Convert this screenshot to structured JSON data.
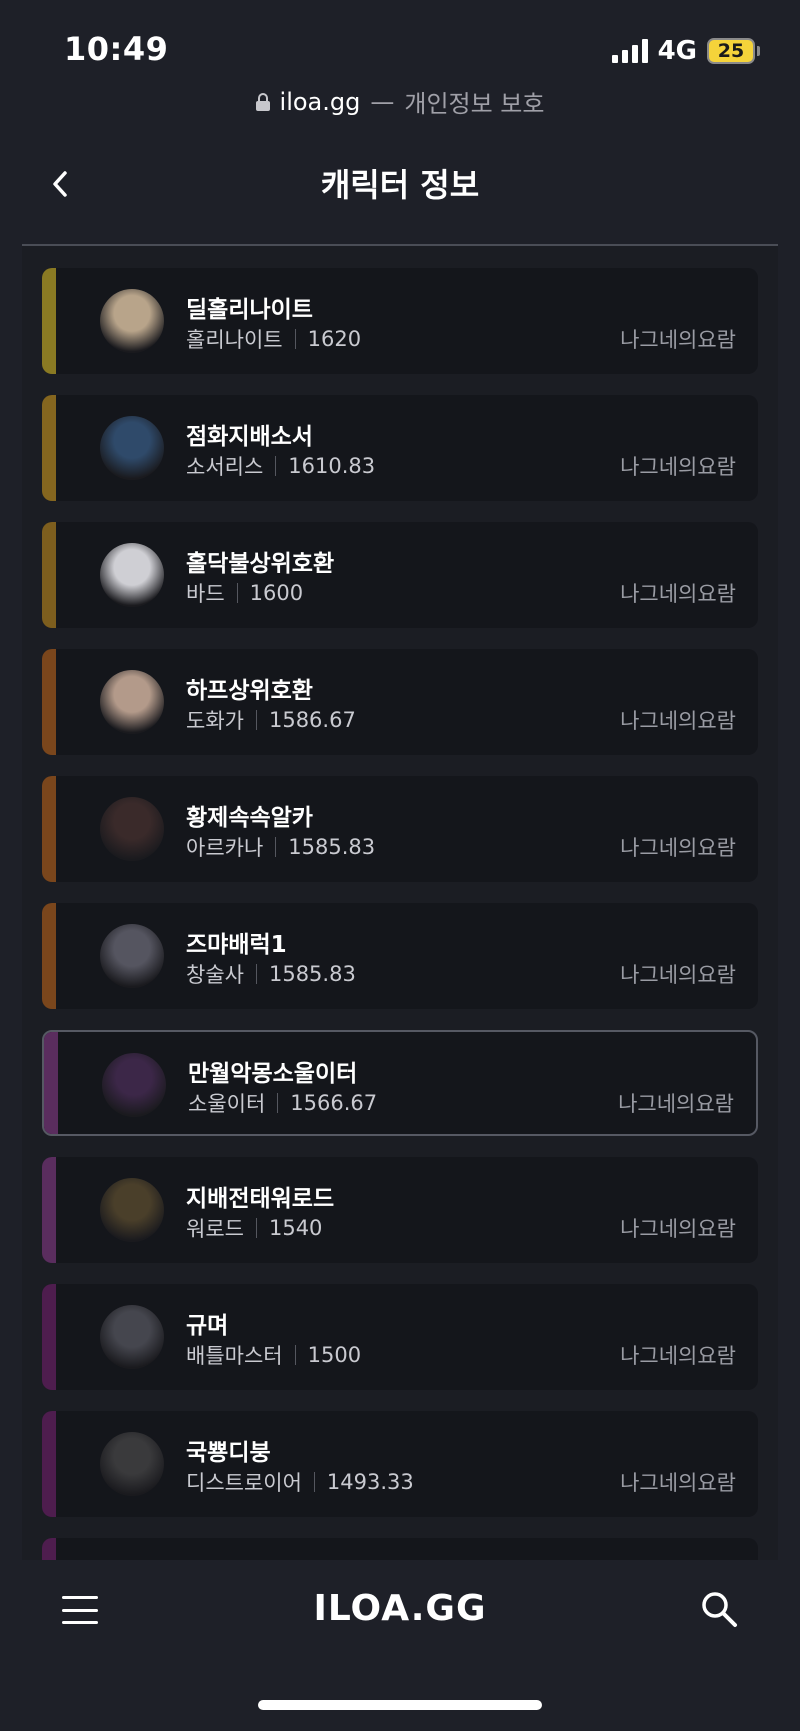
{
  "status": {
    "time": "10:49",
    "network": "4G",
    "battery": "25"
  },
  "browser": {
    "domain": "iloa.gg",
    "separator": "—",
    "privacy": "개인정보 보호"
  },
  "header": {
    "title": "캐릭터 정보"
  },
  "characters": [
    {
      "name": "딜홀리나이트",
      "class": "홀리나이트",
      "level": "1620",
      "server": "나그네의요람",
      "stripe": "#8a7a23",
      "avatar": "#b8a48a"
    },
    {
      "name": "점화지배소서",
      "class": "소서리스",
      "level": "1610.83",
      "server": "나그네의요람",
      "stripe": "#85661f",
      "avatar": "#2f4a6a"
    },
    {
      "name": "홀닥불상위호환",
      "class": "바드",
      "level": "1600",
      "server": "나그네의요람",
      "stripe": "#7d5e1e",
      "avatar": "#cfcfd4"
    },
    {
      "name": "하프상위호환",
      "class": "도화가",
      "level": "1586.67",
      "server": "나그네의요람",
      "stripe": "#7a461c",
      "avatar": "#b39a8a"
    },
    {
      "name": "황제속속알카",
      "class": "아르카나",
      "level": "1585.83",
      "server": "나그네의요람",
      "stripe": "#7a461c",
      "avatar": "#3a2a2a"
    },
    {
      "name": "즈먀배럭1",
      "class": "창술사",
      "level": "1585.83",
      "server": "나그네의요람",
      "stripe": "#7a461c",
      "avatar": "#555560"
    },
    {
      "name": "만월악몽소울이터",
      "class": "소울이터",
      "level": "1566.67",
      "server": "나그네의요람",
      "stripe": "#5a2d5e",
      "avatar": "#3c2748"
    },
    {
      "name": "지배전태워로드",
      "class": "워로드",
      "level": "1540",
      "server": "나그네의요람",
      "stripe": "#5a2d5e",
      "avatar": "#4a3f2a"
    },
    {
      "name": "규며",
      "class": "배틀마스터",
      "level": "1500",
      "server": "나그네의요람",
      "stripe": "#4e1d4e",
      "avatar": "#45464e"
    },
    {
      "name": "국뿅디붕",
      "class": "디스트로이어",
      "level": "1493.33",
      "server": "나그네의요람",
      "stripe": "#4e1d4e",
      "avatar": "#3a3a3c"
    }
  ],
  "bottom": {
    "logo": "ILOA.GG"
  }
}
